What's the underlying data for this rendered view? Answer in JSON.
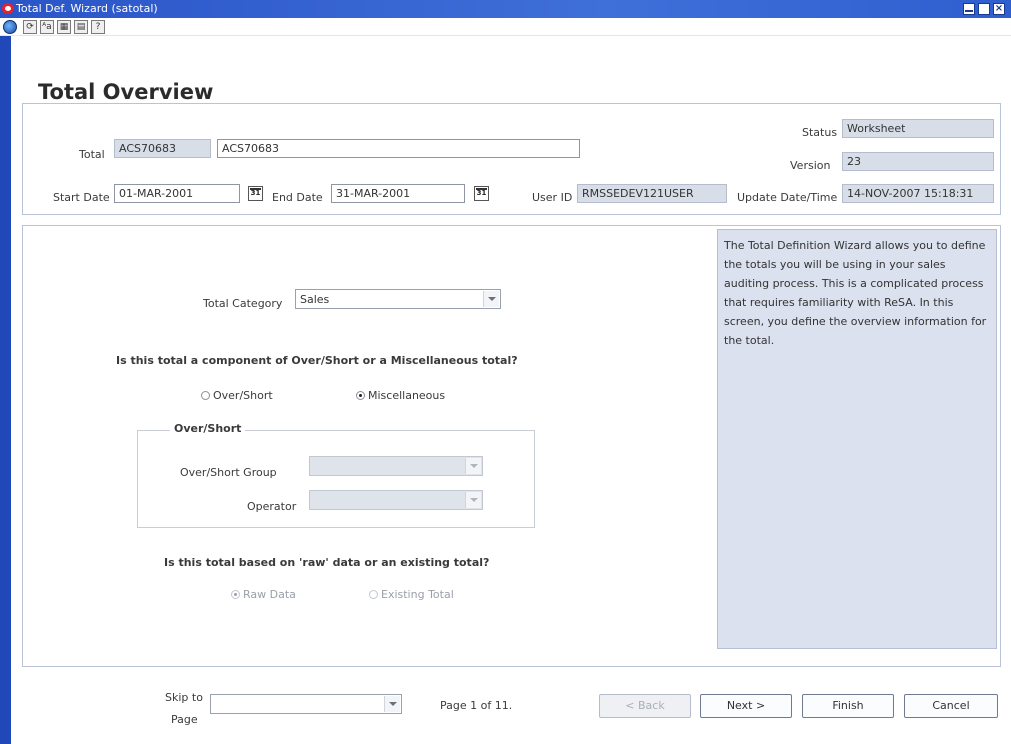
{
  "window": {
    "title": "Total Def. Wizard  (satotal)"
  },
  "toolbar": {
    "icons": [
      "globe-icon",
      "refresh-icon",
      "font-icon",
      "calendar-icon",
      "print-icon",
      "help-icon"
    ],
    "icon_glyphs": [
      "",
      "⟳",
      "ᴬa",
      "▦",
      "▤",
      "?"
    ]
  },
  "page": {
    "title": "Total Overview"
  },
  "header": {
    "total_label": "Total",
    "total_id": "ACS70683",
    "total_desc": "ACS70683",
    "status_label": "Status",
    "status_value": "Worksheet",
    "version_label": "Version",
    "version_value": "23",
    "start_date_label": "Start Date",
    "start_date_value": "01-MAR-2001",
    "end_date_label": "End Date",
    "end_date_value": "31-MAR-2001",
    "calendar_glyph": "31",
    "user_id_label": "User ID",
    "user_id_value": "RMSSEDEV121USER",
    "update_label": "Update Date/Time",
    "update_value": "14-NOV-2007 15:18:31"
  },
  "form": {
    "category_label": "Total Category",
    "category_value": "Sales",
    "question1": "Is this total a component of Over/Short or a Miscellaneous total?",
    "radio_overshort": "Over/Short",
    "radio_misc": "Miscellaneous",
    "group_title": "Over/Short",
    "group_label": "Over/Short Group",
    "group_value": "",
    "operator_label": "Operator",
    "operator_value": "",
    "question2": "Is this total based on 'raw' data or an existing total?",
    "radio_raw": "Raw Data",
    "radio_existing": "Existing Total"
  },
  "help": {
    "text": "The Total Definition Wizard allows you to define the totals you will be using in your sales auditing process.  This is a complicated process that requires familiarity with ReSA.  In this screen, you define the overview information for the total."
  },
  "footer": {
    "skip_label_1": "Skip to",
    "skip_label_2": "Page",
    "skip_value": "",
    "page_info": "Page 1 of 11.",
    "back": "< Back",
    "next": "Next >",
    "finish": "Finish",
    "cancel": "Cancel"
  },
  "colors": {
    "titlebar": "#2a55c8",
    "accent_bar": "#2148b8",
    "readonly_field": "#d8dee8",
    "help_panel": "#dbe1ee"
  }
}
